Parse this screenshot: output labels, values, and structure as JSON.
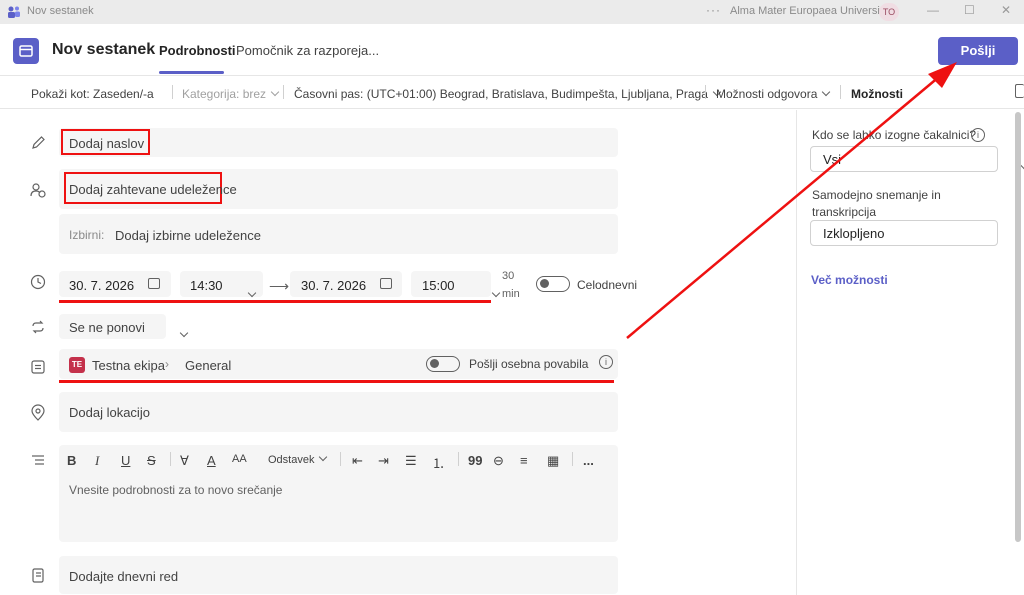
{
  "window": {
    "title": "Nov sestanek",
    "more_icon": "ellipsis-icon",
    "org": "Alma Mater Europaea University",
    "avatar_initials": "TO"
  },
  "header": {
    "title": "Nov sestanek",
    "tabs": [
      {
        "label": "Podrobnosti",
        "active": true
      },
      {
        "label": "Pomočnik za razporeja..."
      }
    ],
    "send_label": "Pošlji",
    "accent_color": "#5b5fc7"
  },
  "toolbar": {
    "show_as": "Pokaži kot: Zaseden/-a",
    "category": "Kategorija: brez",
    "timezone": "Časovni pas: (UTC+01:00) Beograd, Bratislava, Budimpešta, Ljubljana, Praga",
    "response_options": "Možnosti odgovora",
    "options": "Možnosti"
  },
  "form": {
    "title_placeholder": "Dodaj naslov",
    "required_attendees": "Dodaj zahtevane udeležence",
    "optional_label": "Izbirni:",
    "optional_attendees": "Dodaj izbirne udeležence",
    "start_date": "30. 7. 2026",
    "start_time": "14:30",
    "end_date": "30. 7. 2026",
    "end_time": "15:00",
    "duration_value": "30",
    "duration_unit": "min",
    "all_day_label": "Celodnevni",
    "all_day_on": false,
    "repeat": "Se ne ponovi",
    "team_badge": "TE",
    "team": "Testna ekipa",
    "channel": "General",
    "personal_invites_label": "Pošlji osebna povabila",
    "personal_invites_on": false,
    "location": "Dodaj lokacijo",
    "editor_tools": [
      "B",
      "I",
      "U",
      "S",
      "Odstavek",
      "99",
      "..."
    ],
    "paragraph_label": "Odstavek",
    "body_placeholder": "Vnesite podrobnosti za to novo srečanje",
    "agenda": "Dodajte dnevni red"
  },
  "options_panel": {
    "bypass_lobby_label": "Kdo se lahko izogne čakalnici?",
    "bypass_lobby_value": "Vsi",
    "recording_label": "Samodejno snemanje in transkripcija",
    "recording_value": "Izklopljeno",
    "more_options_link": "Več možnosti"
  },
  "annotations": {
    "color": "#e11111"
  }
}
